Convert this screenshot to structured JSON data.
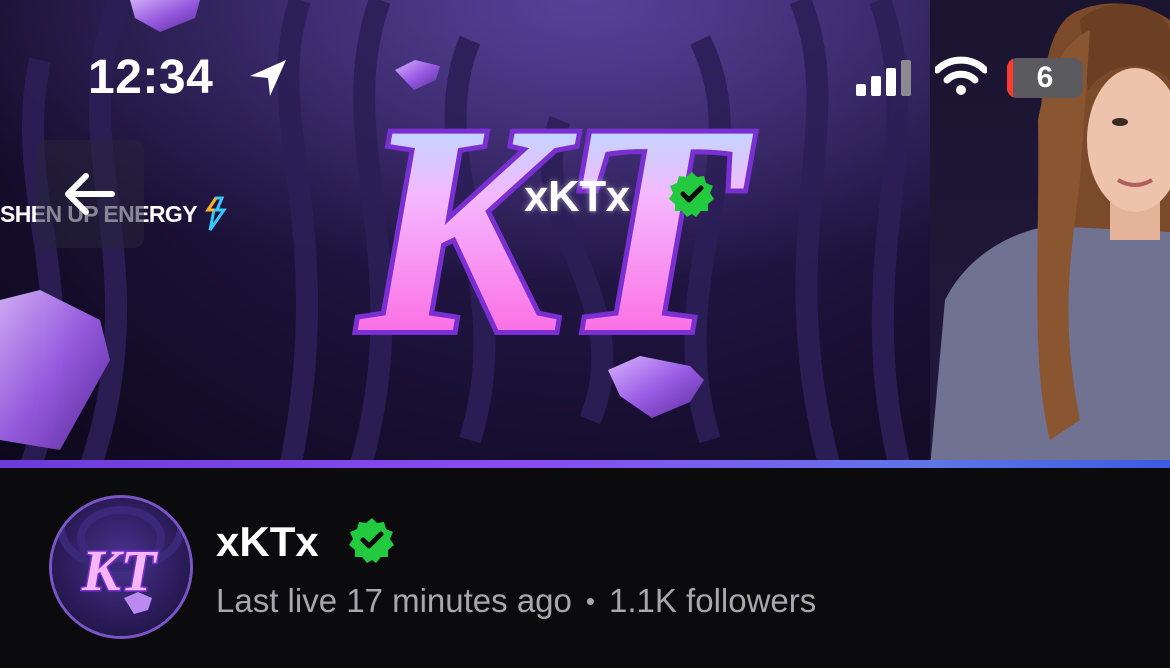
{
  "status_bar": {
    "time": "12:34",
    "battery_level": "6",
    "battery_fraction": 0.06
  },
  "banner": {
    "sponsor_text": "SHEN UP ENERGY",
    "logo_monogram": "KT",
    "logo_name": "xKTx"
  },
  "profile": {
    "channel_name": "xKTx",
    "last_live": "Last live 17 minutes ago",
    "separator": "•",
    "followers": "1.1K followers"
  },
  "colors": {
    "verified": "#23c93f",
    "accent": "#8a4cf0",
    "battery_low": "#ff3b30"
  },
  "icons": [
    "location-arrow-icon",
    "signal-icon",
    "wifi-icon",
    "battery-icon",
    "back-arrow-icon",
    "verified-badge-icon"
  ]
}
